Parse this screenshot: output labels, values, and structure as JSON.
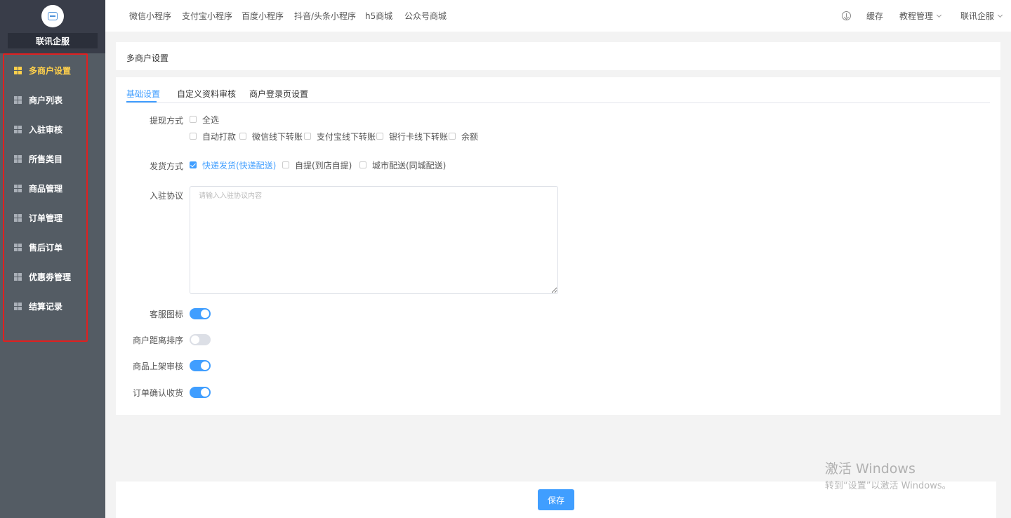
{
  "sidebar": {
    "brand": "联讯企服",
    "items": [
      {
        "label": "多商户设置",
        "active": true
      },
      {
        "label": "商户列表"
      },
      {
        "label": "入驻审核"
      },
      {
        "label": "所售类目"
      },
      {
        "label": "商品管理"
      },
      {
        "label": "订单管理"
      },
      {
        "label": "售后订单"
      },
      {
        "label": "优惠劵管理"
      },
      {
        "label": "结算记录"
      }
    ]
  },
  "topnav": {
    "links": [
      "微信小程序",
      "支付宝小程序",
      "百度小程序",
      "抖音/头条小程序",
      "h5商城",
      "公众号商城"
    ],
    "cache": "缓存",
    "tutorial": "教程管理",
    "user": "联讯企服"
  },
  "page": {
    "title": "多商户设置",
    "tabs": [
      "基础设置",
      "自定义资料审核",
      "商户登录页设置"
    ],
    "withdraw": {
      "label": "提现方式",
      "select_all": "全选",
      "options": [
        {
          "label": "自动打款",
          "checked": false
        },
        {
          "label": "微信线下转账",
          "checked": false
        },
        {
          "label": "支付宝线下转账",
          "checked": false
        },
        {
          "label": "银行卡线下转账",
          "checked": false
        },
        {
          "label": "余额",
          "checked": false
        }
      ]
    },
    "delivery": {
      "label": "发货方式",
      "options": [
        {
          "label": "快递发货(快递配送)",
          "checked": true
        },
        {
          "label": "自提(到店自提)",
          "checked": false
        },
        {
          "label": "城市配送(同城配送)",
          "checked": false
        }
      ]
    },
    "agreement": {
      "label": "入驻协议",
      "placeholder": "请输入入驻协议内容",
      "value": ""
    },
    "switches": [
      {
        "label": "客服图标",
        "on": true
      },
      {
        "label": "商户距离排序",
        "on": false
      },
      {
        "label": "商品上架审核",
        "on": true
      },
      {
        "label": "订单确认收货",
        "on": true
      }
    ],
    "save": "保存"
  },
  "watermark": {
    "line1": "激活 Windows",
    "line2": "转到“设置”以激活 Windows。"
  },
  "colors": {
    "primary": "#409eff",
    "sidebar_bg": "#545c64",
    "active_menu": "#ffd04b",
    "highlight_border": "#e02020"
  }
}
